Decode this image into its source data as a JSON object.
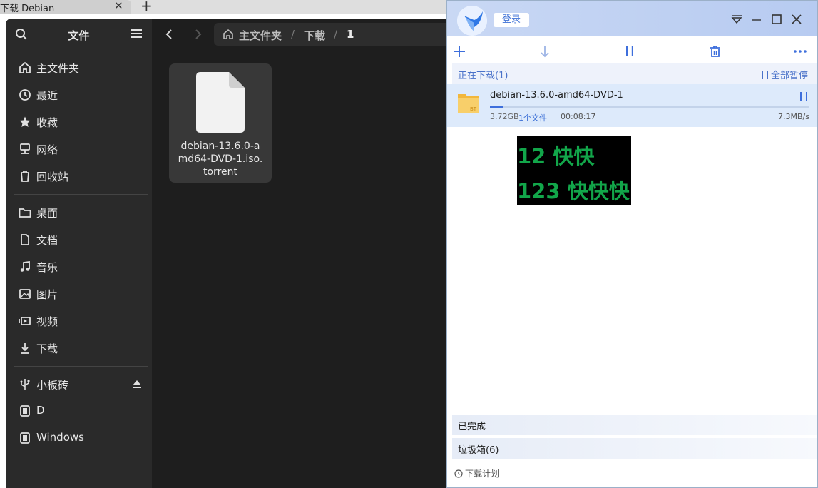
{
  "browser": {
    "tab_title": "下载 Debian",
    "tab_close": "✕",
    "new_tab": "+"
  },
  "file_manager": {
    "sidebar_title": "文件",
    "sidebar_items": [
      {
        "label": "主文件夹",
        "icon": "home-icon"
      },
      {
        "label": "最近",
        "icon": "clock-icon"
      },
      {
        "label": "收藏",
        "icon": "star-icon"
      },
      {
        "label": "网络",
        "icon": "network-icon"
      },
      {
        "label": "回收站",
        "icon": "trash-icon"
      }
    ],
    "places": [
      {
        "label": "桌面",
        "icon": "folder-icon"
      },
      {
        "label": "文档",
        "icon": "document-icon"
      },
      {
        "label": "音乐",
        "icon": "music-icon"
      },
      {
        "label": "图片",
        "icon": "image-icon"
      },
      {
        "label": "视频",
        "icon": "video-icon"
      },
      {
        "label": "下载",
        "icon": "download-icon"
      }
    ],
    "devices": [
      {
        "label": "小板砖",
        "icon": "usb-icon"
      },
      {
        "label": "D",
        "icon": "drive-icon"
      },
      {
        "label": "Windows",
        "icon": "drive-icon"
      }
    ],
    "path": {
      "home": "主文件夹",
      "segments": [
        "下载",
        "1"
      ],
      "separator": "/"
    },
    "file": {
      "name": "debian-13.6.0-amd64-DVD-1.iso.torrent"
    }
  },
  "download_manager": {
    "login_label": "登录",
    "active_section": "正在下载(1)",
    "pause_all": "全部暂停",
    "task": {
      "name": "debian-13.6.0-amd64-DVD-1",
      "size": "3.72GB",
      "files": "1个文件",
      "time_left": "00:08:17",
      "speed": "7.3MB/s",
      "progress": 0.04,
      "type_badge": "BT"
    },
    "overlay_lines": [
      "12 快快",
      "123 快快快"
    ],
    "completed_section": "已完成",
    "trash_section": "垃圾箱(6)",
    "schedule": "下载计划",
    "colors": {
      "accent": "#3e6fdc",
      "header": "#c9d8f4",
      "overlay_text": "#12a64a"
    }
  }
}
